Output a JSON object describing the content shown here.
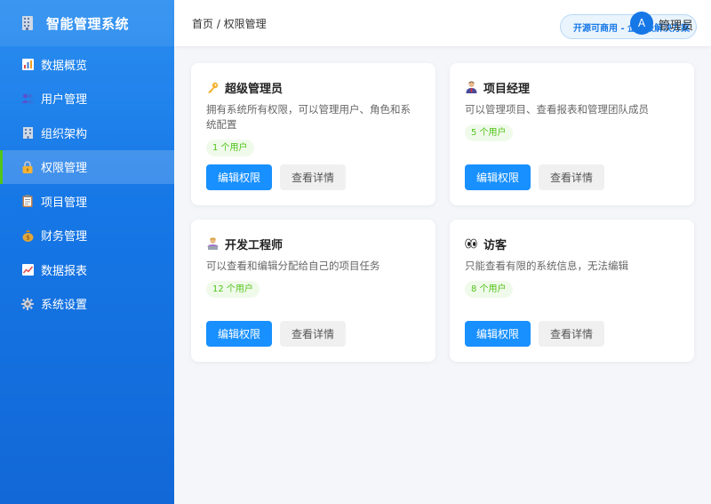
{
  "app": {
    "title": "智能管理系统",
    "icon": "building-icon"
  },
  "sidebar": {
    "items": [
      {
        "label": "数据概览",
        "icon": "chart-icon"
      },
      {
        "label": "用户管理",
        "icon": "users-icon"
      },
      {
        "label": "组织架构",
        "icon": "office-icon"
      },
      {
        "label": "权限管理",
        "icon": "lock-icon",
        "active": true
      },
      {
        "label": "项目管理",
        "icon": "clipboard-icon"
      },
      {
        "label": "财务管理",
        "icon": "money-bag-icon"
      },
      {
        "label": "数据报表",
        "icon": "trend-chart-icon"
      },
      {
        "label": "系统设置",
        "icon": "gear-icon"
      }
    ]
  },
  "header": {
    "breadcrumb": "首页 / 权限管理",
    "promo": "开源可商用 - 企业级解决方案",
    "avatar_letter": "A",
    "user_name": "管理员"
  },
  "roles": [
    {
      "title": "超级管理员",
      "icon": "key-icon",
      "desc": "拥有系统所有权限，可以管理用户、角色和系统配置",
      "count": "1 个用户",
      "edit": "编辑权限",
      "view": "查看详情"
    },
    {
      "title": "项目经理",
      "icon": "manager-icon",
      "desc": "可以管理项目、查看报表和管理团队成员",
      "count": "5 个用户",
      "edit": "编辑权限",
      "view": "查看详情"
    },
    {
      "title": "开发工程师",
      "icon": "developer-icon",
      "desc": "可以查看和编辑分配给自己的项目任务",
      "count": "12 个用户",
      "edit": "编辑权限",
      "view": "查看详情"
    },
    {
      "title": "访客",
      "icon": "eyes-icon",
      "desc": "只能查看有限的系统信息，无法编辑",
      "count": "8 个用户",
      "edit": "编辑权限",
      "view": "查看详情"
    }
  ],
  "colors": {
    "accent": "#1890ff",
    "sidebar": "#1677e6",
    "badge_text": "#52c41a",
    "active_marker": "#52c41a"
  }
}
